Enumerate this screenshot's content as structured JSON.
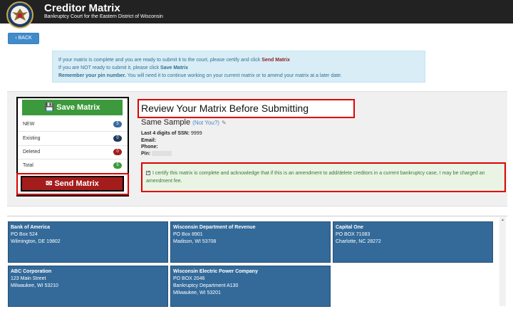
{
  "header": {
    "title": "Creditor Matrix",
    "subtitle": "Bankruptcy Court for the Eastern District of Wisconsin"
  },
  "back_label": "BACK",
  "info": {
    "line1_pre": "If your matrix is complete and you are ready to submit it to the court, please certify and click ",
    "line1_link": "Send Matrix",
    "line2_pre": "If you are NOT ready to submit it, please click ",
    "line2_link": "Save Matrix",
    "line3_bold": "Remember your pin number.",
    "line3_rest": " You will need it to continue working on your current matrix or to amend your matrix at a later date."
  },
  "sidebar": {
    "save_label": "Save Matrix",
    "send_label": "Send Matrix",
    "stats": [
      {
        "label": "NEW",
        "count": "5",
        "color": "#3a6a9c"
      },
      {
        "label": "Existing",
        "count": "0",
        "color": "#1f3b5c"
      },
      {
        "label": "Deleted",
        "count": "0",
        "color": "#a51c1c"
      },
      {
        "label": "Total",
        "count": "5",
        "color": "#3c9a3c"
      }
    ]
  },
  "review": {
    "title": "Review Your Matrix Before Submitting",
    "debtor_name": "Same Sample",
    "not_you": "(Not You?)",
    "ssn_label": "Last 4 digits of SSN:",
    "ssn_value": "9999",
    "email_label": "Email:",
    "phone_label": "Phone:",
    "pin_label": "Pin:"
  },
  "certify_text": "I certify this matrix is complete and acknowledge that if this is an amendment to add/delete creditors in a current bankruptcy case, I may be charged an amendment fee.",
  "creditors": [
    {
      "name": "Bank of America",
      "lines": [
        "PO Box 524",
        "Wilmington, DE 19802"
      ]
    },
    {
      "name": "Wisconsin Department of Revenue",
      "lines": [
        "PO Box 8901",
        "Madison, WI 53708"
      ]
    },
    {
      "name": "Capital One",
      "lines": [
        "PO BOX 71083",
        "Charlotte, NC 28272"
      ]
    },
    {
      "name": "ABC Corporation",
      "lines": [
        "123 Main Street",
        "Milwaukee, WI 53210"
      ]
    },
    {
      "name": "Wisconsin Electric Power Company",
      "lines": [
        "PO BOX 2046",
        "Bankruptcy Department A130",
        "Milwaukee, WI 53201"
      ]
    }
  ]
}
